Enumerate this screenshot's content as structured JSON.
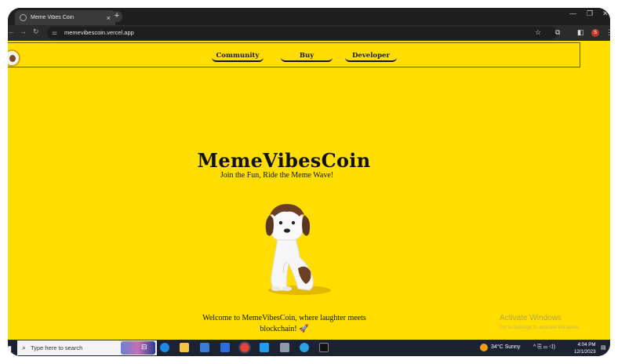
{
  "browser": {
    "tab_title": "Meme Vibes Coin",
    "tab_close": "×",
    "new_tab": "+",
    "url": "memevibescoin.vercel.app",
    "minimize": "—",
    "restore": "❐",
    "close": "✕",
    "profile_initial": "S"
  },
  "site": {
    "nav": [
      {
        "label": "Community"
      },
      {
        "label": "Buy"
      },
      {
        "label": "Developer"
      }
    ],
    "brand": "MemeVibesCoin",
    "tagline": "Join the Fun, Ride the Meme Wave!",
    "welcome_line1": "Welcome to MemeVibesCoin, where laughter meets",
    "welcome_line2": "blockchain! 🚀"
  },
  "watermark": {
    "title": "Activate Windows",
    "subtitle": "Go to Settings to activate Windows."
  },
  "taskbar": {
    "search_placeholder": "Type here to search",
    "weather": "34°C  Sunny",
    "time": "4:04 PM",
    "date": "12/1/2023"
  },
  "colors": {
    "page_bg": "#FFDD00",
    "text": "#111111"
  }
}
